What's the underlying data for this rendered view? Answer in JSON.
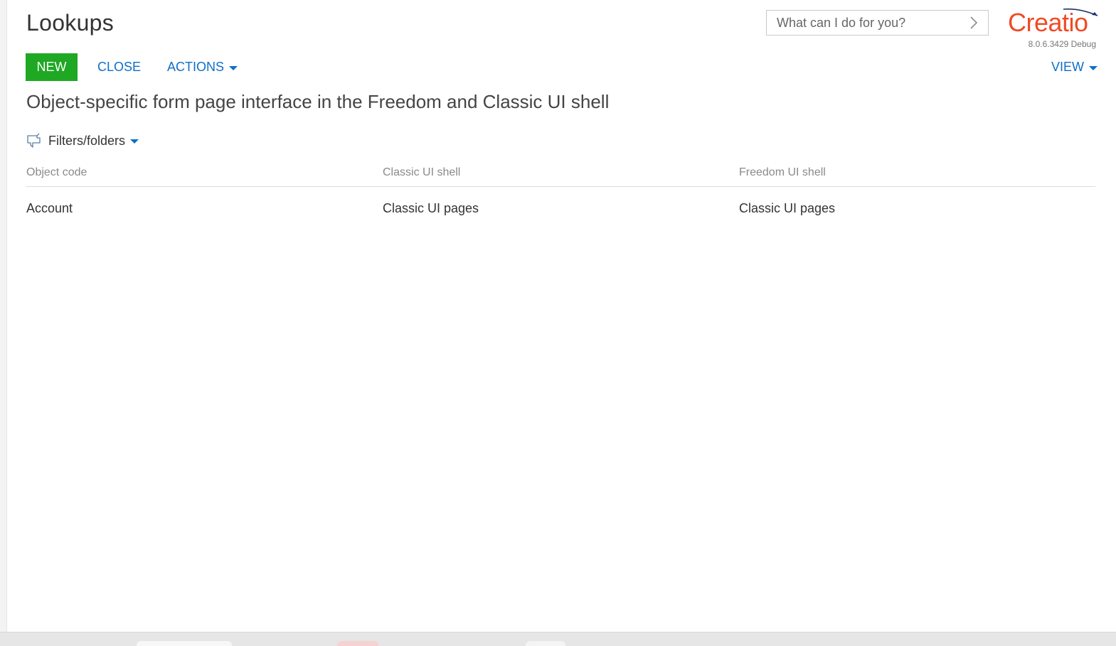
{
  "header": {
    "title": "Lookups",
    "command_placeholder": "What can I do for you?",
    "logo_text": "Creatio",
    "version": "8.0.6.3429 Debug"
  },
  "toolbar": {
    "new_label": "NEW",
    "close_label": "CLOSE",
    "actions_label": "ACTIONS",
    "view_label": "VIEW"
  },
  "section": {
    "title": "Object-specific form page interface in the Freedom and Classic UI shell"
  },
  "filters": {
    "label": "Filters/folders"
  },
  "grid": {
    "columns": [
      "Object code",
      "Classic UI shell",
      "Freedom UI shell"
    ],
    "rows": [
      [
        "Account",
        "Classic UI pages",
        "Classic UI pages"
      ]
    ]
  },
  "colors": {
    "brand": "#ef4b25",
    "primary_button": "#1ea823",
    "link": "#0e6fc7"
  }
}
